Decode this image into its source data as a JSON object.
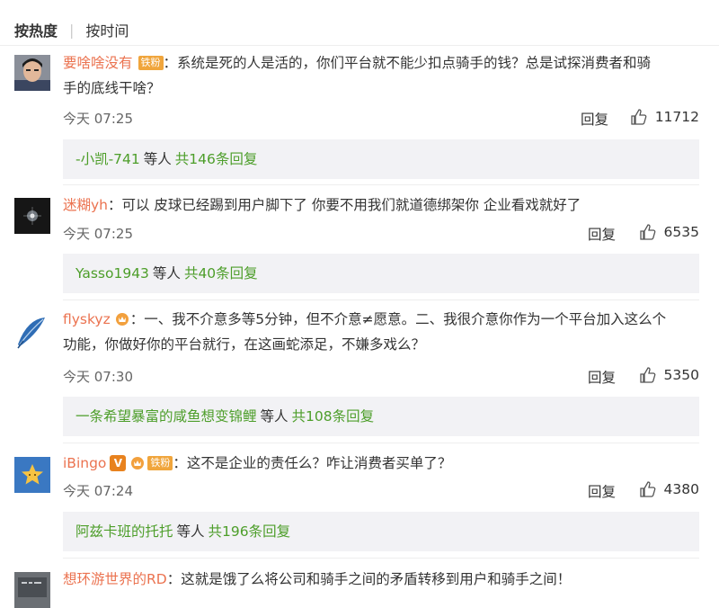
{
  "sort": {
    "active": "按热度",
    "other": "按时间"
  },
  "colors": {
    "username": "#eb7350",
    "reply_user": "#4d9e2a",
    "fan_badge": "#f0a53c",
    "reply_bg": "#f2f2f5"
  },
  "comments": [
    {
      "user": "要啥啥没有",
      "badge": "铁粉",
      "text": "：系统是死的人是活的，你们平台就不能少扣点骑手的钱？总是试探消费者和骑手的底线干啥？",
      "line1": "：系统是死的人是活的，你们平台就不能少扣点骑手的钱？总是试探消费者和骑",
      "line2": "手的底线干啥？",
      "time": "今天 07:25",
      "reply_label": "回复",
      "likes": "11712",
      "replies": {
        "first_user": "-小凯-741",
        "mid": "等人",
        "count": "共146条回复"
      }
    },
    {
      "user": "迷糊yh",
      "text": "：可以 皮球已经踢到用户脚下了 你要不用我们就道德绑架你 企业看戏就好了",
      "time": "今天 07:25",
      "reply_label": "回复",
      "likes": "6535",
      "replies": {
        "first_user": "Yasso1943",
        "mid": "等人",
        "count": "共40条回复"
      }
    },
    {
      "user": "flyskyz",
      "text": "：一、我不介意多等5分钟，但不介意≠愿意。二、我很介意你作为一个平台加入这么个功能，你做好你的平台就行，在这画蛇添足，不嫌多戏么？",
      "line1": "：一、我不介意多等5分钟，但不介意≠愿意。二、我很介意你作为一个平台加入这么个",
      "line2": "功能，你做好你的平台就行，在这画蛇添足，不嫌多戏么？",
      "time": "今天 07:30",
      "reply_label": "回复",
      "likes": "5350",
      "replies": {
        "first_user": "一条希望暴富的咸鱼想变锦鲤",
        "mid": "等人",
        "count": "共108条回复"
      }
    },
    {
      "user": "iBingo",
      "badge": "铁粉",
      "vip": "V",
      "text": "：这不是企业的责任么？咋让消费者买单了？",
      "time": "今天 07:24",
      "reply_label": "回复",
      "likes": "4380",
      "replies": {
        "first_user": "阿兹卡班的托托",
        "mid": "等人",
        "count": "共196条回复"
      }
    },
    {
      "user": "想环游世界的RD",
      "text": "：这就是饿了么将公司和骑手之间的矛盾转移到用户和骑手之间！"
    }
  ]
}
